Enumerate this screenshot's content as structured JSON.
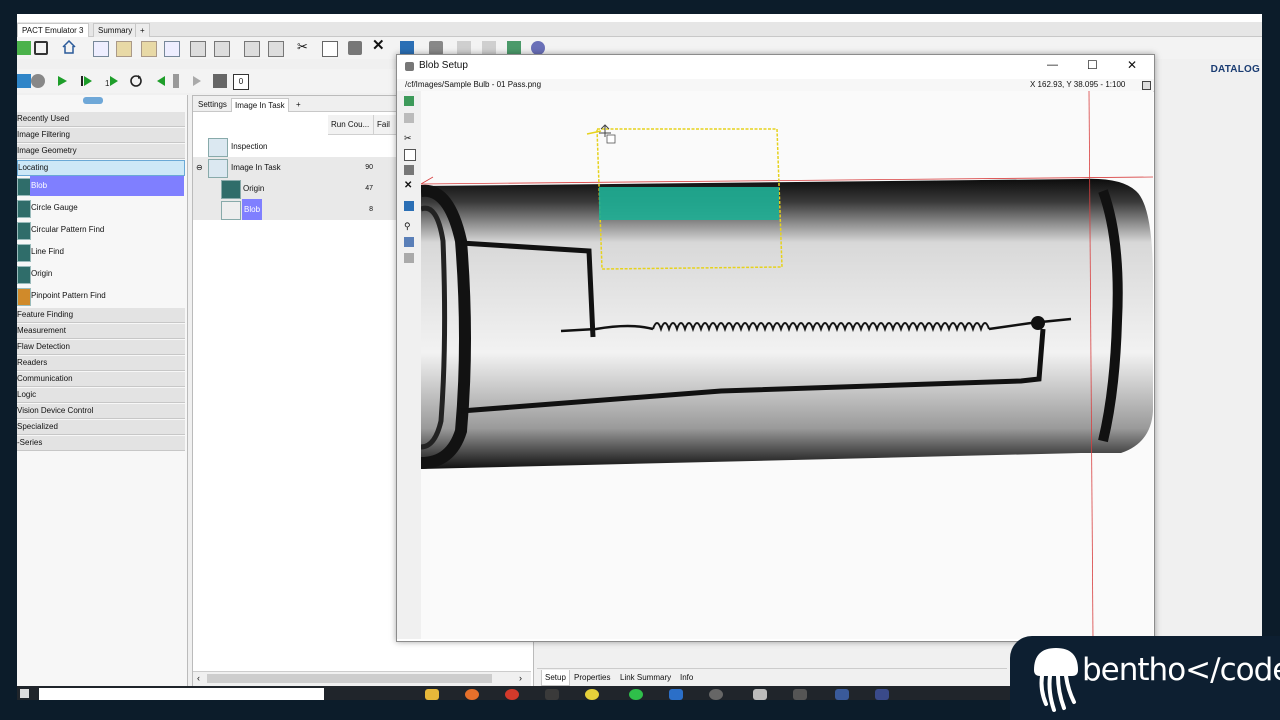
{
  "app": {
    "doc_tabs": [
      {
        "label": "PACT Emulator 3",
        "active": true
      },
      {
        "label": "Summary",
        "active": false
      },
      {
        "label": "+",
        "active": false
      }
    ],
    "brand": "DATALOG"
  },
  "left_panel": {
    "categories_top": [
      "Recently Used",
      "Image Filtering",
      "Image Geometry",
      "Locating"
    ],
    "tools": [
      "Blob",
      "Circle Gauge",
      "Circular Pattern Find",
      "Line Find",
      "Origin",
      "Pinpoint Pattern Find"
    ],
    "categories_bottom": [
      "Feature Finding",
      "Measurement",
      "Flaw Detection",
      "Readers",
      "Communication",
      "Logic",
      "Vision Device Control",
      "Specialized",
      "-Series"
    ]
  },
  "mid_panel": {
    "tabs": [
      "Settings",
      "Image In Task",
      "+"
    ],
    "columns": [
      "Run Cou...",
      "Fail"
    ],
    "rows": [
      {
        "name": "Inspection",
        "value": ""
      },
      {
        "name": "Image In Task",
        "value": "90"
      },
      {
        "name": "Origin",
        "value": "47"
      },
      {
        "name": "Blob",
        "value": "8"
      }
    ]
  },
  "bottom_tabs": [
    "Setup",
    "Properties",
    "Link Summary",
    "Info"
  ],
  "dialog": {
    "title": "Blob Setup",
    "path": "/cf/Images/Sample Bulb - 01 Pass.png",
    "coords": "X 162.93, Y 38.095 - 1:100",
    "buttons": {
      "minimize": "—",
      "maximize": "☐",
      "close": "✕"
    }
  },
  "logo": {
    "text": "bentho</code>"
  },
  "colors": {
    "selection": "#7f7fff",
    "roi": "#e6d21c",
    "blob_fill": "#1fae94",
    "accent": "#1a3c72"
  }
}
